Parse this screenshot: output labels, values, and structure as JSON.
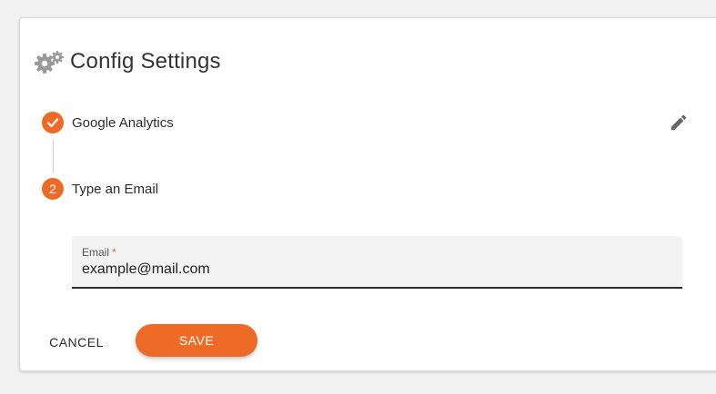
{
  "colors": {
    "accent": "#ed6b26",
    "text": "#2b2b2b",
    "card": "#ffffff",
    "background": "#f2f2f2"
  },
  "header": {
    "icon": "gears-icon",
    "title": "Config Settings"
  },
  "stepper": {
    "steps": [
      {
        "label": "Google Analytics",
        "status": "completed",
        "icon": "check-icon"
      },
      {
        "label": "Type an Email",
        "status": "active",
        "number": "2"
      }
    ],
    "edit_icon": "pencil-icon"
  },
  "form": {
    "email": {
      "label": "Email",
      "required_marker": "*",
      "value": "example@mail.com"
    }
  },
  "actions": {
    "cancel_label": "CANCEL",
    "save_label": "SAVE"
  }
}
